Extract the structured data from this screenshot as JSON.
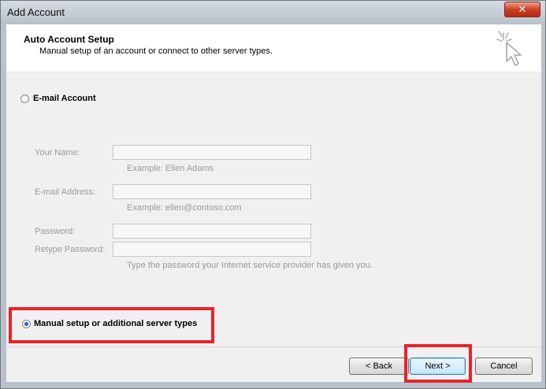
{
  "window": {
    "title": "Add Account",
    "close_glyph": "✕"
  },
  "header": {
    "title": "Auto Account Setup",
    "subtitle": "Manual setup of an account or connect to other server types.",
    "icon": "wizard-cursor-icon"
  },
  "email_account": {
    "label": "E-mail Account",
    "checked": false,
    "fields": {
      "your_name": {
        "label": "Your Name:",
        "value": "",
        "example": "Example: Ellen Adams"
      },
      "email_address": {
        "label": "E-mail Address:",
        "value": "",
        "example": "Example: ellen@contoso.com"
      },
      "password": {
        "label": "Password:",
        "value": ""
      },
      "retype_password": {
        "label": "Retype Password:",
        "value": ""
      },
      "password_hint": "Type the password your Internet service provider has given you."
    }
  },
  "manual_setup": {
    "label": "Manual setup or additional server types",
    "checked": true
  },
  "footer": {
    "back_label": "< Back",
    "next_label": "Next >",
    "cancel_label": "Cancel"
  },
  "colors": {
    "highlight": "#e8232b",
    "radio_selected": "#2a62c6",
    "disabled_text": "#9a9a9a"
  }
}
